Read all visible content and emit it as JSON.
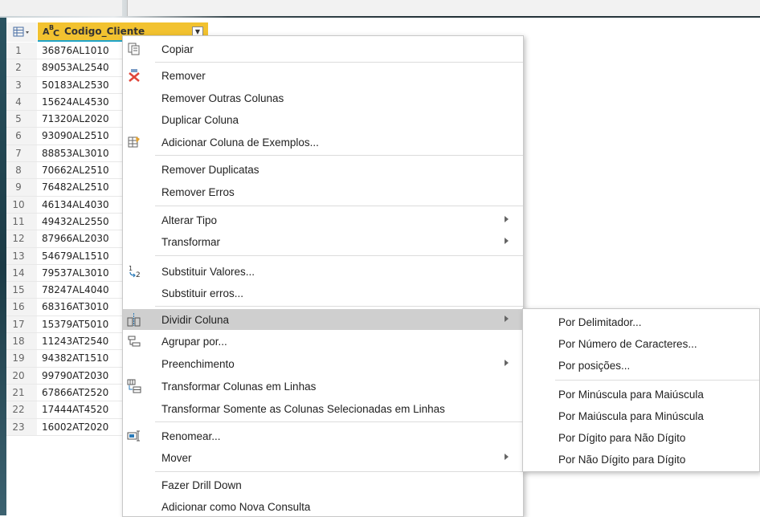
{
  "column": {
    "type_label": "A B C",
    "name": "Codigo_Cliente",
    "dropdown_icon": "chevron-down-icon"
  },
  "rows": [
    {
      "n": "1",
      "v": "36876AL1010"
    },
    {
      "n": "2",
      "v": "89053AL2540"
    },
    {
      "n": "3",
      "v": "50183AL2530"
    },
    {
      "n": "4",
      "v": "15624AL4530"
    },
    {
      "n": "5",
      "v": "71320AL2020"
    },
    {
      "n": "6",
      "v": "93090AL2510"
    },
    {
      "n": "7",
      "v": "88853AL3010"
    },
    {
      "n": "8",
      "v": "70662AL2510"
    },
    {
      "n": "9",
      "v": "76482AL2510"
    },
    {
      "n": "10",
      "v": "46134AL4030"
    },
    {
      "n": "11",
      "v": "49432AL2550"
    },
    {
      "n": "12",
      "v": "87966AL2030"
    },
    {
      "n": "13",
      "v": "54679AL1510"
    },
    {
      "n": "14",
      "v": "79537AL3010"
    },
    {
      "n": "15",
      "v": "78247AL4040"
    },
    {
      "n": "16",
      "v": "68316AT3010"
    },
    {
      "n": "17",
      "v": "15379AT5010"
    },
    {
      "n": "18",
      "v": "11243AT2540"
    },
    {
      "n": "19",
      "v": "94382AT1510"
    },
    {
      "n": "20",
      "v": "99790AT2030"
    },
    {
      "n": "21",
      "v": "67866AT2520"
    },
    {
      "n": "22",
      "v": "17444AT4520"
    },
    {
      "n": "23",
      "v": "16002AT2020"
    }
  ],
  "menu": {
    "copy": "Copiar",
    "remove": "Remover",
    "remove_other": "Remover Outras Colunas",
    "duplicate": "Duplicar Coluna",
    "add_from_examples": "Adicionar Coluna de Exemplos...",
    "remove_duplicates": "Remover Duplicatas",
    "remove_errors": "Remover Erros",
    "change_type": "Alterar Tipo",
    "transform": "Transformar",
    "replace_values": "Substituir Valores...",
    "replace_errors": "Substituir erros...",
    "split_column": "Dividir Coluna",
    "group_by": "Agrupar por...",
    "fill": "Preenchimento",
    "unpivot": "Transformar Colunas em Linhas",
    "unpivot_only": "Transformar Somente as Colunas Selecionadas em Linhas",
    "rename": "Renomear...",
    "move": "Mover",
    "drill_down": "Fazer Drill Down",
    "add_as_query": "Adicionar como Nova Consulta"
  },
  "submenu": {
    "by_delimiter": "Por Delimitador...",
    "by_num_chars": "Por Número de Caracteres...",
    "by_positions": "Por posições...",
    "lower_to_upper": "Por Minúscula para Maiúscula",
    "upper_to_lower": "Por Maiúscula para Minúscula",
    "digit_to_nondigit": "Por Dígito para Não Dígito",
    "nondigit_to_digit": "Por Não Dígito para Dígito"
  },
  "colors": {
    "column_header": "#f2c230",
    "highlight": "#cfcfcf",
    "remove_icon": "#e0463a"
  }
}
